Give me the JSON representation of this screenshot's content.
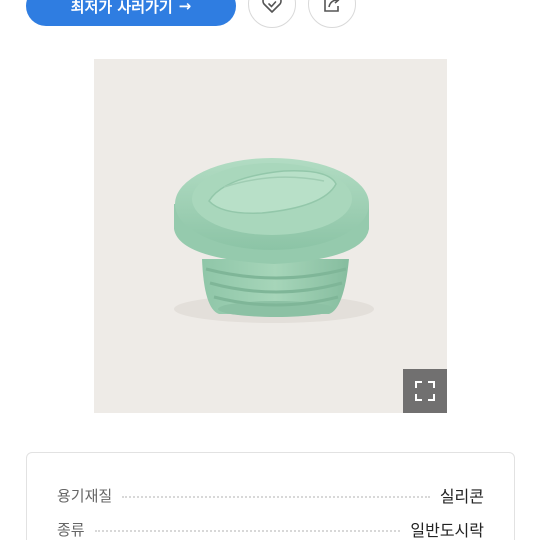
{
  "top_bar": {
    "cta_label": "최저가 사러가기",
    "cta_arrow": "→",
    "wish_icon": "heart-check-icon",
    "share_icon": "share-icon"
  },
  "product": {
    "image_description_icon": "silicone-container-image",
    "expand_icon": "expand-icon"
  },
  "specs": [
    {
      "label": "용기재질",
      "value": "실리콘"
    },
    {
      "label": "종류",
      "value": "일반도시락"
    }
  ],
  "colors": {
    "accent": "#2f7de1",
    "image_bg": "#eeebe7",
    "container_mint": "#9fd0b4"
  }
}
